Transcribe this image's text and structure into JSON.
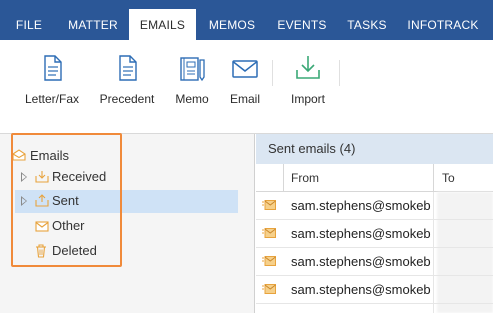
{
  "tabs": [
    {
      "label": "FILE",
      "active": false
    },
    {
      "label": "MATTER",
      "active": false
    },
    {
      "label": "EMAILS",
      "active": true
    },
    {
      "label": "MEMOS",
      "active": false
    },
    {
      "label": "EVENTS",
      "active": false
    },
    {
      "label": "TASKS",
      "active": false
    },
    {
      "label": "INFOTRACK",
      "active": false
    }
  ],
  "ribbon": {
    "buttons": [
      {
        "label": "Letter/Fax",
        "icon": "document-icon"
      },
      {
        "label": "Precedent",
        "icon": "document-icon"
      },
      {
        "label": "Memo",
        "icon": "memo-icon"
      },
      {
        "label": "Email",
        "icon": "envelope-icon"
      },
      {
        "label": "Import",
        "icon": "download-icon"
      }
    ]
  },
  "tree": {
    "root": "Emails",
    "items": [
      {
        "label": "Received",
        "icon": "inbox-icon",
        "expandable": true
      },
      {
        "label": "Sent",
        "icon": "outbox-icon",
        "expandable": true,
        "selected": true
      },
      {
        "label": "Other",
        "icon": "envelope-icon",
        "expandable": false
      },
      {
        "label": "Deleted",
        "icon": "trash-icon",
        "expandable": false
      }
    ]
  },
  "list": {
    "header": "Sent emails (4)",
    "columns": [
      "From",
      "To"
    ],
    "rows": [
      {
        "from": "sam.stephens@smokeb"
      },
      {
        "from": "sam.stephens@smokeb"
      },
      {
        "from": "sam.stephens@smokeb"
      },
      {
        "from": "sam.stephens@smokeb"
      }
    ]
  },
  "colors": {
    "tab_bar": "#2b5797",
    "accent_blue": "#2d6db5",
    "highlight_orange": "#f08a3a",
    "selection": "#cfe2f6",
    "list_header": "#dbe6f2",
    "envelope_gold": "#e8a33d",
    "import_green": "#3aa876"
  }
}
